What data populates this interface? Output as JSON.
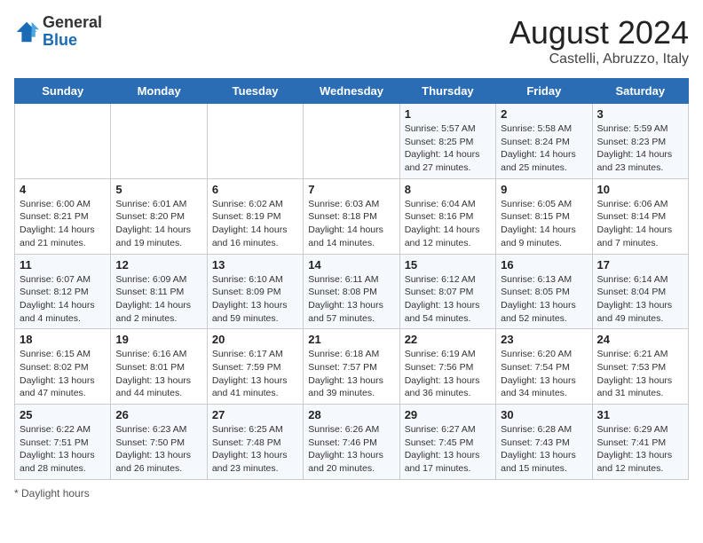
{
  "header": {
    "logo_general": "General",
    "logo_blue": "Blue",
    "title": "August 2024",
    "subtitle": "Castelli, Abruzzo, Italy"
  },
  "days_of_week": [
    "Sunday",
    "Monday",
    "Tuesday",
    "Wednesday",
    "Thursday",
    "Friday",
    "Saturday"
  ],
  "weeks": [
    [
      {
        "day": "",
        "info": ""
      },
      {
        "day": "",
        "info": ""
      },
      {
        "day": "",
        "info": ""
      },
      {
        "day": "",
        "info": ""
      },
      {
        "day": "1",
        "info": "Sunrise: 5:57 AM\nSunset: 8:25 PM\nDaylight: 14 hours and 27 minutes."
      },
      {
        "day": "2",
        "info": "Sunrise: 5:58 AM\nSunset: 8:24 PM\nDaylight: 14 hours and 25 minutes."
      },
      {
        "day": "3",
        "info": "Sunrise: 5:59 AM\nSunset: 8:23 PM\nDaylight: 14 hours and 23 minutes."
      }
    ],
    [
      {
        "day": "4",
        "info": "Sunrise: 6:00 AM\nSunset: 8:21 PM\nDaylight: 14 hours and 21 minutes."
      },
      {
        "day": "5",
        "info": "Sunrise: 6:01 AM\nSunset: 8:20 PM\nDaylight: 14 hours and 19 minutes."
      },
      {
        "day": "6",
        "info": "Sunrise: 6:02 AM\nSunset: 8:19 PM\nDaylight: 14 hours and 16 minutes."
      },
      {
        "day": "7",
        "info": "Sunrise: 6:03 AM\nSunset: 8:18 PM\nDaylight: 14 hours and 14 minutes."
      },
      {
        "day": "8",
        "info": "Sunrise: 6:04 AM\nSunset: 8:16 PM\nDaylight: 14 hours and 12 minutes."
      },
      {
        "day": "9",
        "info": "Sunrise: 6:05 AM\nSunset: 8:15 PM\nDaylight: 14 hours and 9 minutes."
      },
      {
        "day": "10",
        "info": "Sunrise: 6:06 AM\nSunset: 8:14 PM\nDaylight: 14 hours and 7 minutes."
      }
    ],
    [
      {
        "day": "11",
        "info": "Sunrise: 6:07 AM\nSunset: 8:12 PM\nDaylight: 14 hours and 4 minutes."
      },
      {
        "day": "12",
        "info": "Sunrise: 6:09 AM\nSunset: 8:11 PM\nDaylight: 14 hours and 2 minutes."
      },
      {
        "day": "13",
        "info": "Sunrise: 6:10 AM\nSunset: 8:09 PM\nDaylight: 13 hours and 59 minutes."
      },
      {
        "day": "14",
        "info": "Sunrise: 6:11 AM\nSunset: 8:08 PM\nDaylight: 13 hours and 57 minutes."
      },
      {
        "day": "15",
        "info": "Sunrise: 6:12 AM\nSunset: 8:07 PM\nDaylight: 13 hours and 54 minutes."
      },
      {
        "day": "16",
        "info": "Sunrise: 6:13 AM\nSunset: 8:05 PM\nDaylight: 13 hours and 52 minutes."
      },
      {
        "day": "17",
        "info": "Sunrise: 6:14 AM\nSunset: 8:04 PM\nDaylight: 13 hours and 49 minutes."
      }
    ],
    [
      {
        "day": "18",
        "info": "Sunrise: 6:15 AM\nSunset: 8:02 PM\nDaylight: 13 hours and 47 minutes."
      },
      {
        "day": "19",
        "info": "Sunrise: 6:16 AM\nSunset: 8:01 PM\nDaylight: 13 hours and 44 minutes."
      },
      {
        "day": "20",
        "info": "Sunrise: 6:17 AM\nSunset: 7:59 PM\nDaylight: 13 hours and 41 minutes."
      },
      {
        "day": "21",
        "info": "Sunrise: 6:18 AM\nSunset: 7:57 PM\nDaylight: 13 hours and 39 minutes."
      },
      {
        "day": "22",
        "info": "Sunrise: 6:19 AM\nSunset: 7:56 PM\nDaylight: 13 hours and 36 minutes."
      },
      {
        "day": "23",
        "info": "Sunrise: 6:20 AM\nSunset: 7:54 PM\nDaylight: 13 hours and 34 minutes."
      },
      {
        "day": "24",
        "info": "Sunrise: 6:21 AM\nSunset: 7:53 PM\nDaylight: 13 hours and 31 minutes."
      }
    ],
    [
      {
        "day": "25",
        "info": "Sunrise: 6:22 AM\nSunset: 7:51 PM\nDaylight: 13 hours and 28 minutes."
      },
      {
        "day": "26",
        "info": "Sunrise: 6:23 AM\nSunset: 7:50 PM\nDaylight: 13 hours and 26 minutes."
      },
      {
        "day": "27",
        "info": "Sunrise: 6:25 AM\nSunset: 7:48 PM\nDaylight: 13 hours and 23 minutes."
      },
      {
        "day": "28",
        "info": "Sunrise: 6:26 AM\nSunset: 7:46 PM\nDaylight: 13 hours and 20 minutes."
      },
      {
        "day": "29",
        "info": "Sunrise: 6:27 AM\nSunset: 7:45 PM\nDaylight: 13 hours and 17 minutes."
      },
      {
        "day": "30",
        "info": "Sunrise: 6:28 AM\nSunset: 7:43 PM\nDaylight: 13 hours and 15 minutes."
      },
      {
        "day": "31",
        "info": "Sunrise: 6:29 AM\nSunset: 7:41 PM\nDaylight: 13 hours and 12 minutes."
      }
    ]
  ],
  "footer": {
    "note": "Daylight hours"
  }
}
